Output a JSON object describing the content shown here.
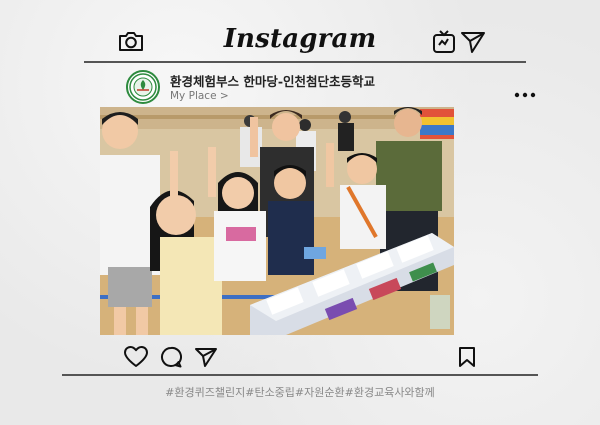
{
  "app": {
    "brand": "Instagram"
  },
  "post": {
    "account_name": "환경체험부스 한마당-인천첨단초등학교",
    "place_label": "My Place >",
    "hashtags": "#환경퀴즈챌린지#탄소중립#자원순환#환경교육사와함께"
  },
  "icons": {
    "top_left": "camera-icon",
    "top_right": [
      "igtv-icon",
      "send-icon"
    ],
    "more": "more-options-icon",
    "actions": [
      "heart-icon",
      "comment-icon",
      "share-icon",
      "bookmark-icon"
    ]
  },
  "colors": {
    "frame_line": "#555555",
    "logo_green": "#2e8b3f",
    "hashtag_gray": "#888888"
  }
}
